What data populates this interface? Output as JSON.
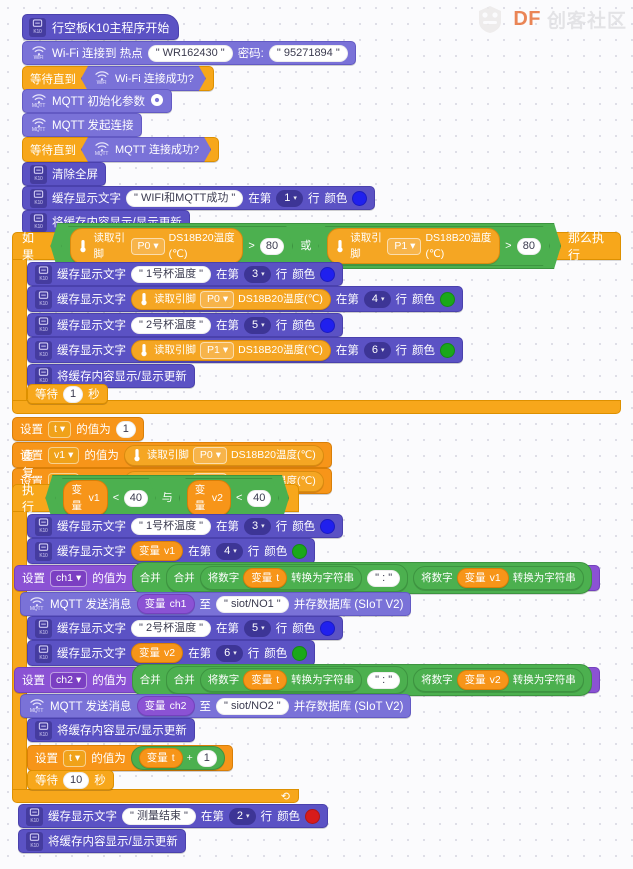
{
  "watermark": {
    "brand": "DF",
    "community": "创客社区"
  },
  "labels": {
    "wait_until": "等待直到",
    "if": "如果",
    "then": "那么执行",
    "or": "或",
    "and": "与",
    "repeat_until": "重复执行直到",
    "set": "设置",
    "set_value_to": "的值为",
    "wait": "等待",
    "seconds": "秒",
    "at_line": "在第",
    "line_unit": "行",
    "color": "颜色",
    "variable": "变量",
    "join": "合并",
    "num_to_str_pre": "将数字",
    "num_to_str_post": "转换为字符串",
    "read_pin": "读取引脚",
    "ds18b20": "DS18B20温度(℃)",
    "caret": "▾"
  },
  "blocks": {
    "hat_start": "行空板K10主程序开始",
    "wifi_connect": {
      "text": "Wi-Fi 连接到 热点",
      "ssid": "\" WR162430 \"",
      "pwd_label": "密码:",
      "pwd": "\" 95271894 \""
    },
    "wifi_connected": "Wi-Fi 连接成功?",
    "mqtt_init": "MQTT 初始化参数",
    "mqtt_connect": "MQTT 发起连接",
    "mqtt_connected": "MQTT 连接成功?",
    "clear_screen": "清除全屏",
    "buffer_show_text": "缓存显示文字",
    "flush_display": "将缓存内容显示/显示更新",
    "mqtt_send_pre": "MQTT 发送消息",
    "mqtt_send_to": "至",
    "mqtt_send_post": "并存数据库 (SIoT V2)"
  },
  "values": {
    "t": "t",
    "v1": "v1",
    "v2": "v2",
    "ch1": "ch1",
    "ch2": "ch2",
    "pin_p0": "P0",
    "pin_p1": "P1",
    "threshold_80": "80",
    "threshold_40": "40",
    "one": "1",
    "ten": "10",
    "gt": ">",
    "lt": "<",
    "plus": "+",
    "colon_str": "\" : \"",
    "topic1": "\" siot/NO1 \"",
    "topic2": "\" siot/NO2 \"",
    "msg_wifi_mqtt_ok": "\" WIFI和MQTT成功 \"",
    "msg_cup1": "\" 1号杯温度 \"",
    "msg_cup2": "\" 2号杯温度 \"",
    "msg_done": "\" 测量结束 \"",
    "line1": "1",
    "line2": "2",
    "line3": "3",
    "line4": "4",
    "line5": "5",
    "line6": "6"
  },
  "colors": {
    "blue_swatch": "#2020ee",
    "green_swatch": "#1aa81a",
    "red_swatch": "#d81b1b",
    "control_orange": "#f7a71b",
    "variable_orange": "#f79519",
    "display_purple": "#5b52c4",
    "net_purple": "#7a72d8",
    "operator_green": "#4cb04f",
    "mqtt_var_purple": "#8b52d4"
  }
}
